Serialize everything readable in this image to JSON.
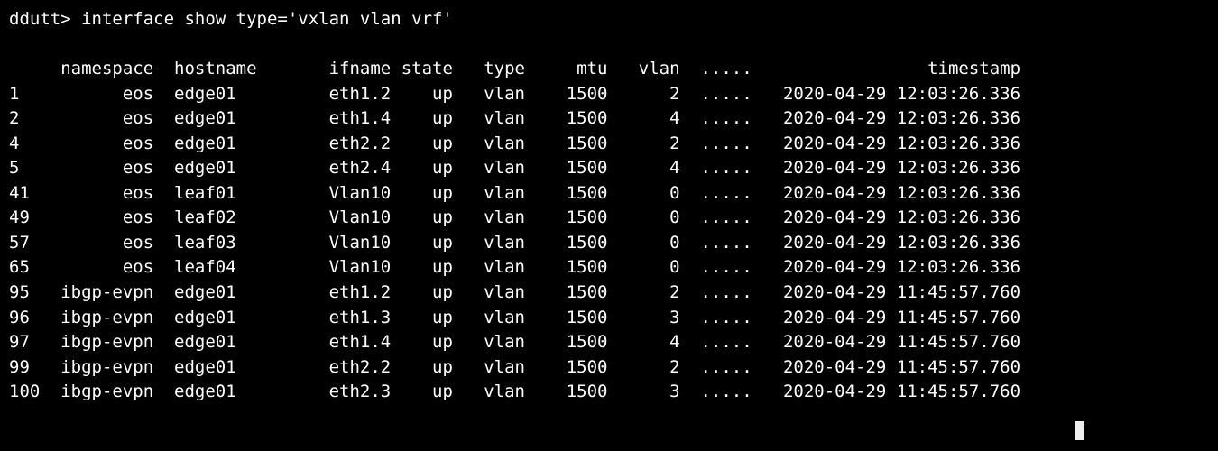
{
  "prompt": "ddutt> ",
  "command": "interface show type='vxlan vlan vrf'",
  "headers": {
    "idx": "",
    "namespace": "namespace",
    "hostname": "hostname",
    "ifname": "ifname",
    "state": "state",
    "type": "type",
    "mtu": "mtu",
    "vlan": "vlan",
    "dots": ".....",
    "timestamp": "timestamp"
  },
  "rows": [
    {
      "idx": "1",
      "namespace": "eos",
      "hostname": "edge01",
      "ifname": "eth1.2",
      "state": "up",
      "type": "vlan",
      "mtu": "1500",
      "vlan": "2",
      "dots": ".....",
      "timestamp": "2020-04-29 12:03:26.336"
    },
    {
      "idx": "2",
      "namespace": "eos",
      "hostname": "edge01",
      "ifname": "eth1.4",
      "state": "up",
      "type": "vlan",
      "mtu": "1500",
      "vlan": "4",
      "dots": ".....",
      "timestamp": "2020-04-29 12:03:26.336"
    },
    {
      "idx": "4",
      "namespace": "eos",
      "hostname": "edge01",
      "ifname": "eth2.2",
      "state": "up",
      "type": "vlan",
      "mtu": "1500",
      "vlan": "2",
      "dots": ".....",
      "timestamp": "2020-04-29 12:03:26.336"
    },
    {
      "idx": "5",
      "namespace": "eos",
      "hostname": "edge01",
      "ifname": "eth2.4",
      "state": "up",
      "type": "vlan",
      "mtu": "1500",
      "vlan": "4",
      "dots": ".....",
      "timestamp": "2020-04-29 12:03:26.336"
    },
    {
      "idx": "41",
      "namespace": "eos",
      "hostname": "leaf01",
      "ifname": "Vlan10",
      "state": "up",
      "type": "vlan",
      "mtu": "1500",
      "vlan": "0",
      "dots": ".....",
      "timestamp": "2020-04-29 12:03:26.336"
    },
    {
      "idx": "49",
      "namespace": "eos",
      "hostname": "leaf02",
      "ifname": "Vlan10",
      "state": "up",
      "type": "vlan",
      "mtu": "1500",
      "vlan": "0",
      "dots": ".....",
      "timestamp": "2020-04-29 12:03:26.336"
    },
    {
      "idx": "57",
      "namespace": "eos",
      "hostname": "leaf03",
      "ifname": "Vlan10",
      "state": "up",
      "type": "vlan",
      "mtu": "1500",
      "vlan": "0",
      "dots": ".....",
      "timestamp": "2020-04-29 12:03:26.336"
    },
    {
      "idx": "65",
      "namespace": "eos",
      "hostname": "leaf04",
      "ifname": "Vlan10",
      "state": "up",
      "type": "vlan",
      "mtu": "1500",
      "vlan": "0",
      "dots": ".....",
      "timestamp": "2020-04-29 12:03:26.336"
    },
    {
      "idx": "95",
      "namespace": "ibgp-evpn",
      "hostname": "edge01",
      "ifname": "eth1.2",
      "state": "up",
      "type": "vlan",
      "mtu": "1500",
      "vlan": "2",
      "dots": ".....",
      "timestamp": "2020-04-29 11:45:57.760"
    },
    {
      "idx": "96",
      "namespace": "ibgp-evpn",
      "hostname": "edge01",
      "ifname": "eth1.3",
      "state": "up",
      "type": "vlan",
      "mtu": "1500",
      "vlan": "3",
      "dots": ".....",
      "timestamp": "2020-04-29 11:45:57.760"
    },
    {
      "idx": "97",
      "namespace": "ibgp-evpn",
      "hostname": "edge01",
      "ifname": "eth1.4",
      "state": "up",
      "type": "vlan",
      "mtu": "1500",
      "vlan": "4",
      "dots": ".....",
      "timestamp": "2020-04-29 11:45:57.760"
    },
    {
      "idx": "99",
      "namespace": "ibgp-evpn",
      "hostname": "edge01",
      "ifname": "eth2.2",
      "state": "up",
      "type": "vlan",
      "mtu": "1500",
      "vlan": "2",
      "dots": ".....",
      "timestamp": "2020-04-29 11:45:57.760"
    },
    {
      "idx": "100",
      "namespace": "ibgp-evpn",
      "hostname": "edge01",
      "ifname": "eth2.3",
      "state": "up",
      "type": "vlan",
      "mtu": "1500",
      "vlan": "3",
      "dots": ".....",
      "timestamp": "2020-04-29 11:45:57.760"
    }
  ]
}
